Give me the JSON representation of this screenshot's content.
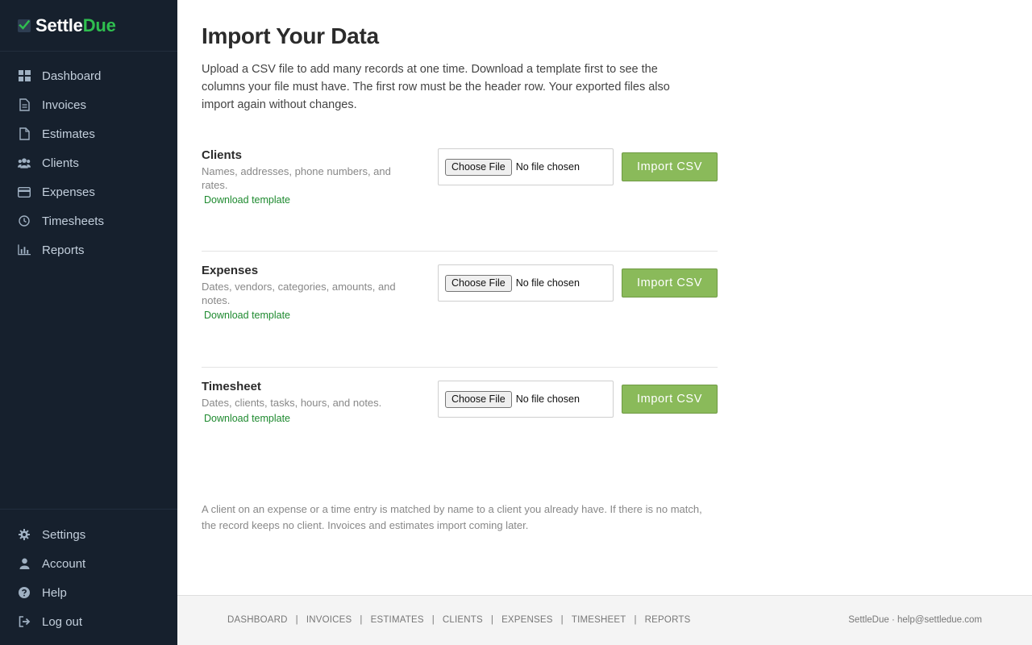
{
  "brand": {
    "name_part1": "Settle",
    "name_part2": "Due"
  },
  "sidebar": {
    "items": [
      {
        "label": "Dashboard",
        "icon": "grid-icon"
      },
      {
        "label": "Invoices",
        "icon": "document-icon"
      },
      {
        "label": "Estimates",
        "icon": "file-icon"
      },
      {
        "label": "Clients",
        "icon": "users-icon"
      },
      {
        "label": "Expenses",
        "icon": "credit-card-icon"
      },
      {
        "label": "Timesheets",
        "icon": "clock-icon"
      },
      {
        "label": "Reports",
        "icon": "bar-chart-icon"
      }
    ],
    "bottom_items": [
      {
        "label": "Settings",
        "icon": "gear-icon"
      },
      {
        "label": "Account",
        "icon": "user-icon"
      },
      {
        "label": "Help",
        "icon": "question-icon"
      },
      {
        "label": "Log out",
        "icon": "logout-icon"
      }
    ]
  },
  "main": {
    "title": "Import Your Data",
    "intro": "Upload a CSV file to add many records at one time. Download a template first to see the columns your file must have. The first row must be the header row. Your exported files also import again without changes.",
    "sections": [
      {
        "title": "Clients",
        "description": "Names, addresses, phone numbers, and rates.",
        "template_link": "Download template",
        "choose_label": "Choose File",
        "no_file_label": "No file chosen",
        "import_label": "Import CSV"
      },
      {
        "title": "Expenses",
        "description": "Dates, vendors, categories, amounts, and notes.",
        "template_link": "Download template",
        "choose_label": "Choose File",
        "no_file_label": "No file chosen",
        "import_label": "Import CSV"
      },
      {
        "title": "Timesheet",
        "description": "Dates, clients, tasks, hours, and notes.",
        "template_link": "Download template",
        "choose_label": "Choose File",
        "no_file_label": "No file chosen",
        "import_label": "Import CSV"
      }
    ],
    "footnote": "A client on an expense or a time entry is matched by name to a client you already have. If there is no match, the record keeps no client. Invoices and estimates import coming later."
  },
  "footer": {
    "links": [
      "DASHBOARD",
      "INVOICES",
      "ESTIMATES",
      "CLIENTS",
      "EXPENSES",
      "TIMESHEET",
      "REPORTS"
    ],
    "separator": "|",
    "right_text": "SettleDue · help@settledue.com"
  },
  "colors": {
    "sidebar_bg": "#16202d",
    "brand_accent": "#2fbf4f",
    "import_button": "#8aba5a",
    "link": "#1e8a2f"
  }
}
